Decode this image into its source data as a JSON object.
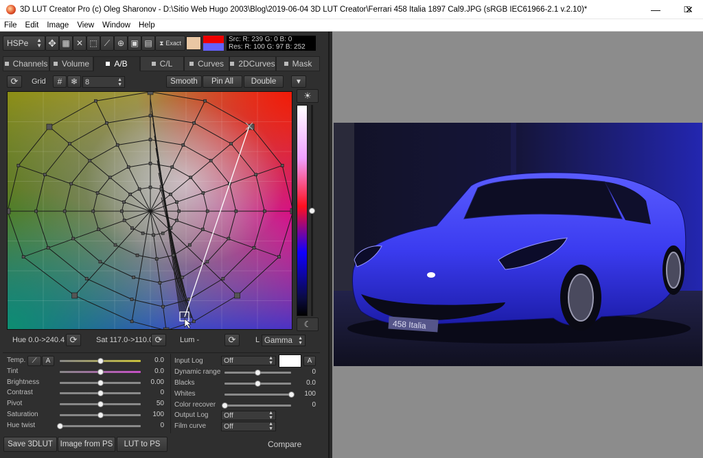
{
  "window": {
    "title": "3D LUT Creator Pro (c) Oleg Sharonov - D:\\Sitio Web Hugo 2003\\Blog\\2019-06-04 3D LUT Creator\\Ferrari 458 Italia 1897 Cal9.JPG (sRGB IEC61966-2.1 v.2.10)*",
    "minimize": "—",
    "maximize": "☐",
    "close": "✕"
  },
  "menu": [
    "File",
    "Edit",
    "Image",
    "View",
    "Window",
    "Help"
  ],
  "toolbar": {
    "mode": "HSPe",
    "exact_label": "Exact",
    "src_label": "Src: R: 239  G: 0  B: 0",
    "res_label": "Res: R: 100  G: 97  B: 252",
    "src_color": "#ef0000",
    "res_color": "#6461fc",
    "swatch_color": "#e9c7a4"
  },
  "tabs": [
    {
      "label": "Channels"
    },
    {
      "label": "Volume"
    },
    {
      "label": "A/B"
    },
    {
      "label": "C/L"
    },
    {
      "label": "Curves"
    },
    {
      "label": "2DCurves"
    },
    {
      "label": "Mask"
    }
  ],
  "grid_row": {
    "grid_label": "Grid",
    "grid_value": "8",
    "smooth": "Smooth",
    "pin_all": "Pin All",
    "double": "Double"
  },
  "status_row": {
    "hue": "Hue 0.0->240.4",
    "sat": "Sat 117.0->110.0",
    "lum": "Lum -",
    "l_label": "L",
    "gamma": "Gamma"
  },
  "adjustments_left": [
    {
      "label": "Temp.",
      "value": "0.0",
      "level": 0.5,
      "color": "#c9c23a"
    },
    {
      "label": "Tint",
      "value": "0.0",
      "level": 0.5,
      "color": "#c64fc6"
    },
    {
      "label": "Brightness",
      "value": "0.00",
      "level": 0.5,
      "color": "#8a8a8a"
    },
    {
      "label": "Contrast",
      "value": "0",
      "level": 0.5,
      "color": "#8a8a8a"
    },
    {
      "label": "Pivot",
      "value": "50",
      "level": 0.5,
      "color": "#8a8a8a"
    },
    {
      "label": "Saturation",
      "value": "100",
      "level": 0.5,
      "color": "#8a8a8a"
    },
    {
      "label": "Hue twist",
      "value": "0",
      "level": 0.0,
      "color": "#8a8a8a"
    }
  ],
  "adjustments_right": {
    "input_log": {
      "label": "Input Log",
      "value": "Off"
    },
    "sliders": [
      {
        "label": "Dynamic range",
        "value": "0",
        "level": 0.5
      },
      {
        "label": "Blacks",
        "value": "0.0",
        "level": 0.5
      },
      {
        "label": "Whites",
        "value": "100",
        "level": 1.0
      },
      {
        "label": "Color recover",
        "value": "0",
        "level": 0.0
      }
    ],
    "output_log": {
      "label": "Output Log",
      "value": "Off"
    },
    "film_curve": {
      "label": "Film curve",
      "value": "Off"
    }
  },
  "bottom": {
    "save": "Save 3DLUT",
    "image_from_ps": "Image from PS",
    "lut_to_ps": "LUT to PS",
    "compare": "Compare"
  },
  "preview": {
    "car_badge": "458 Italia"
  }
}
